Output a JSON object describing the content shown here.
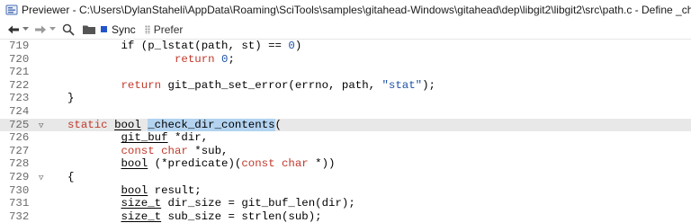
{
  "window": {
    "title": "Previewer - C:\\Users\\DylanStaheli\\AppData\\Roaming\\SciTools\\samples\\gitahead-Windows\\gitahead\\dep\\libgit2\\libgit2\\src\\path.c - Define _check_dir_contents",
    "icon": "previewer-app-icon"
  },
  "toolbar": {
    "back_icon": "arrow-left-icon",
    "forward_icon": "arrow-right-icon",
    "search_icon": "magnifier-icon",
    "folder_icon": "folder-icon",
    "sync_label": "Sync",
    "prefer_label": "Prefer"
  },
  "colors": {
    "keyword": "#c0392b",
    "number": "#1f52a8",
    "string": "#1f52a8",
    "selection": "#b3d3f0",
    "current_line": "#e8e8e8",
    "sync_accent": "#2255cc"
  },
  "code": {
    "lines": [
      {
        "num": "719",
        "fold": "",
        "tokens": [
          [
            "        if (p_lstat(path, st) == ",
            ""
          ],
          [
            "0",
            "num"
          ],
          [
            ")",
            ""
          ]
        ]
      },
      {
        "num": "720",
        "fold": "",
        "tokens": [
          [
            "                ",
            ""
          ],
          [
            "return",
            "kw"
          ],
          [
            " ",
            ""
          ],
          [
            "0",
            "num"
          ],
          [
            ";",
            ""
          ]
        ]
      },
      {
        "num": "721",
        "fold": "",
        "tokens": []
      },
      {
        "num": "722",
        "fold": "",
        "tokens": [
          [
            "        ",
            ""
          ],
          [
            "return",
            "kw"
          ],
          [
            " git_path_set_error(errno, path, ",
            ""
          ],
          [
            "\"stat\"",
            "str"
          ],
          [
            ");",
            ""
          ]
        ]
      },
      {
        "num": "723",
        "fold": "",
        "tokens": [
          [
            "}",
            ""
          ]
        ]
      },
      {
        "num": "724",
        "fold": "",
        "tokens": []
      },
      {
        "num": "725",
        "fold": "▽",
        "highlight": true,
        "tokens": [
          [
            "static",
            "kw"
          ],
          [
            " ",
            ""
          ],
          [
            "bool",
            "ul"
          ],
          [
            " ",
            ""
          ],
          [
            "_check_dir_contents",
            "sel"
          ],
          [
            "(",
            ""
          ]
        ]
      },
      {
        "num": "726",
        "fold": "",
        "tokens": [
          [
            "        ",
            ""
          ],
          [
            "git_buf",
            "ul"
          ],
          [
            " *dir,",
            ""
          ]
        ]
      },
      {
        "num": "727",
        "fold": "",
        "tokens": [
          [
            "        ",
            ""
          ],
          [
            "const",
            "kw"
          ],
          [
            " ",
            ""
          ],
          [
            "char",
            "kw"
          ],
          [
            " *sub,",
            ""
          ]
        ]
      },
      {
        "num": "728",
        "fold": "",
        "tokens": [
          [
            "        ",
            ""
          ],
          [
            "bool",
            "ul"
          ],
          [
            " (*predicate)(",
            ""
          ],
          [
            "const",
            "kw"
          ],
          [
            " ",
            ""
          ],
          [
            "char",
            "kw"
          ],
          [
            " *))",
            ""
          ]
        ]
      },
      {
        "num": "729",
        "fold": "▽",
        "tokens": [
          [
            "{",
            ""
          ]
        ]
      },
      {
        "num": "730",
        "fold": "",
        "tokens": [
          [
            "        ",
            ""
          ],
          [
            "bool",
            "ul"
          ],
          [
            " result;",
            ""
          ]
        ]
      },
      {
        "num": "731",
        "fold": "",
        "tokens": [
          [
            "        ",
            ""
          ],
          [
            "size_t",
            "ul"
          ],
          [
            " dir_size = git_buf_len(dir);",
            ""
          ]
        ]
      },
      {
        "num": "732",
        "fold": "",
        "tokens": [
          [
            "        ",
            ""
          ],
          [
            "size_t",
            "ul"
          ],
          [
            " sub_size = strlen(sub);",
            ""
          ]
        ]
      }
    ]
  }
}
